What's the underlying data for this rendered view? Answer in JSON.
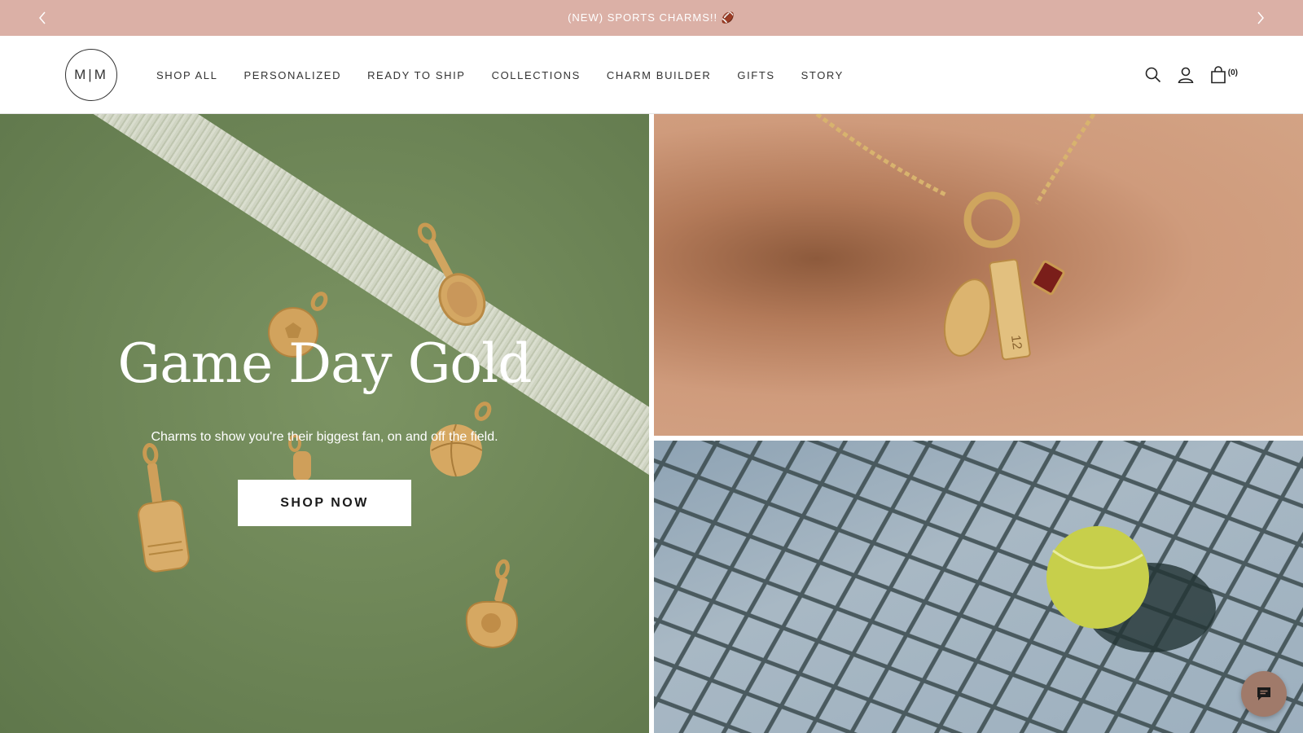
{
  "announcement": {
    "text": "(NEW) SPORTS CHARMS!! 🏈",
    "prev_icon": "chevron-left-icon",
    "next_icon": "chevron-right-icon"
  },
  "header": {
    "logo_text": "M|M",
    "nav": [
      {
        "label": "SHOP ALL"
      },
      {
        "label": "PERSONALIZED"
      },
      {
        "label": "READY TO SHIP"
      },
      {
        "label": "COLLECTIONS"
      },
      {
        "label": "CHARM BUILDER"
      },
      {
        "label": "GIFTS"
      },
      {
        "label": "STORY"
      }
    ],
    "icons": [
      "search-icon",
      "account-icon",
      "cart-icon"
    ],
    "cart_count": "(0)"
  },
  "hero": {
    "title": "Game Day Gold",
    "subtitle": "Charms to show you're their biggest fan, on and off the field.",
    "cta_label": "SHOP NOW",
    "necklace_tag_text": "12"
  },
  "chat": {
    "icon": "chat-icon"
  },
  "colors": {
    "announcement_bg": "#dbb0a6",
    "hero_green": "#6f8758",
    "gold": "#d3a75f",
    "chat_bg": "#a07a6a"
  }
}
